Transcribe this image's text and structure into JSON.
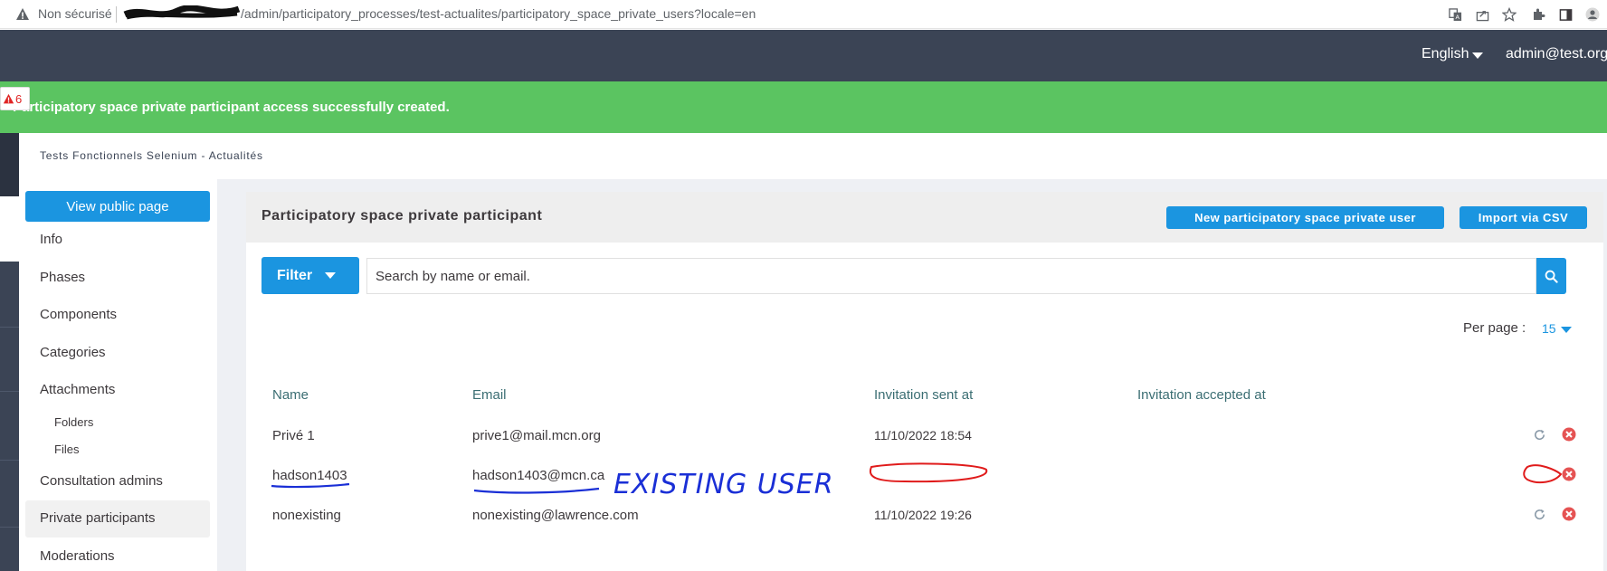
{
  "browser": {
    "security_label": "Non sécurisé",
    "url_path": "/admin/participatory_processes/test-actualites/participatory_space_private_users?locale=en",
    "icons": [
      "translate-icon",
      "share-icon",
      "star-icon",
      "extensions-icon",
      "sidebar-icon",
      "profile-icon"
    ]
  },
  "topbar": {
    "language": "English",
    "user_email": "admin@test.org"
  },
  "flash": {
    "message": "Participatory space private participant access successfully created.",
    "error_badge_count": "6"
  },
  "breadcrumb": "Tests Fonctionnels Selenium - Actualités",
  "sidebar": {
    "view_public": "View public page",
    "items": [
      {
        "label": "Info"
      },
      {
        "label": "Phases"
      },
      {
        "label": "Components"
      },
      {
        "label": "Categories"
      },
      {
        "label": "Attachments"
      },
      {
        "label": "Folders"
      },
      {
        "label": "Files"
      },
      {
        "label": "Consultation admins"
      },
      {
        "label": "Private participants"
      },
      {
        "label": "Moderations"
      }
    ],
    "active": "Private participants"
  },
  "card": {
    "title": "Participatory space private participant",
    "new_button": "New participatory space private user",
    "import_button": "Import via CSV"
  },
  "filter": {
    "button": "Filter",
    "search_placeholder": "Search by name or email."
  },
  "pagination": {
    "per_page_label": "Per page :",
    "per_page_value": "15"
  },
  "table": {
    "headers": [
      "Name",
      "Email",
      "Invitation sent at",
      "Invitation accepted at"
    ],
    "rows": [
      {
        "name": "Privé 1",
        "email": "prive1@mail.mcn.org",
        "sent_at": "11/10/2022 18:54",
        "accepted_at": "",
        "has_resend": true
      },
      {
        "name": "hadson1403",
        "email": "hadson1403@mcn.ca",
        "sent_at": "",
        "accepted_at": "",
        "has_resend": false
      },
      {
        "name": "nonexisting",
        "email": "nonexisting@lawrence.com",
        "sent_at": "11/10/2022 19:26",
        "accepted_at": "",
        "has_resend": true
      }
    ]
  },
  "annotation": {
    "handwritten_note": "EXISTING USER"
  },
  "colors": {
    "primary": "#1b95e0",
    "topbar": "#3b4455",
    "success": "#5bc461",
    "delete": "#e55353",
    "annotation_blue": "#1a2fd6",
    "annotation_red": "#e01b1b"
  }
}
